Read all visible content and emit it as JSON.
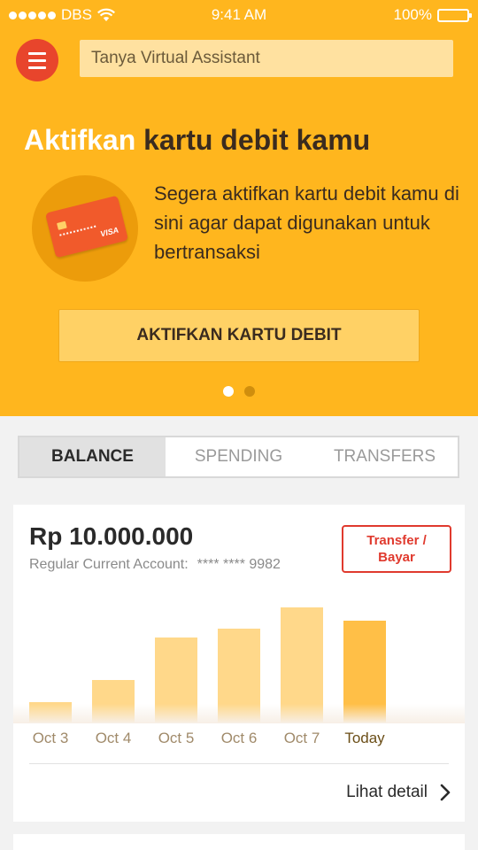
{
  "status_bar": {
    "carrier": "DBS",
    "time": "9:41 AM",
    "battery": "100%"
  },
  "header": {
    "search_placeholder": "Tanya Virtual Assistant"
  },
  "hero": {
    "title_highlight": "Aktifkan",
    "title_rest": " kartu debit kamu",
    "description": "Segera aktifkan kartu debit kamu di sini agar dapat digunakan untuk bertransaksi",
    "card_brand": "VISA",
    "cta_label": "AKTIFKAN KARTU DEBIT",
    "page_count": 2,
    "active_page": 1
  },
  "tabs": [
    {
      "label": "BALANCE",
      "active": true
    },
    {
      "label": "SPENDING",
      "active": false
    },
    {
      "label": "TRANSFERS",
      "active": false
    }
  ],
  "account": {
    "balance": "Rp 10.000.000",
    "account_type": "Regular Current Account:",
    "account_number": "**** **** 9982",
    "transfer_label": "Transfer /\nBayar"
  },
  "chart_data": {
    "type": "bar",
    "categories": [
      "Oct 3",
      "Oct 4",
      "Oct 5",
      "Oct 6",
      "Oct 7",
      "Today"
    ],
    "values": [
      22,
      45,
      90,
      100,
      122,
      108
    ],
    "ylim": [
      0,
      130
    ],
    "highlighted": "Today",
    "colors": {
      "bar": "#ffd88a",
      "today": "#ffbf47"
    }
  },
  "detail_link": "Lihat detail",
  "colors": {
    "hero_bg": "#ffb61e",
    "accent_red": "#e03a2e",
    "text_dark": "#3a2b1f"
  }
}
